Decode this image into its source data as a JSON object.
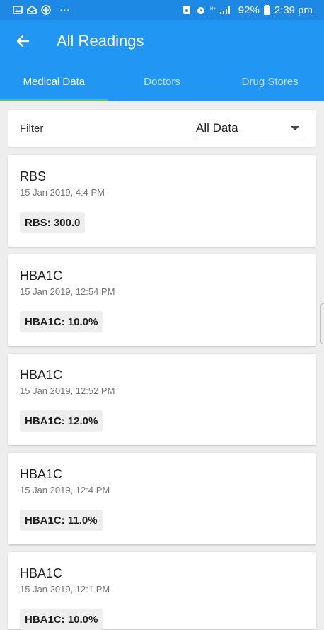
{
  "status_bar": {
    "left_icons": [
      "image-icon",
      "mail-icon",
      "game-icon",
      "more-icon"
    ],
    "battery": "92%",
    "time": "2:39 pm"
  },
  "app_bar": {
    "title": "All Readings"
  },
  "tabs": [
    {
      "label": "Medical Data",
      "active": true
    },
    {
      "label": "Doctors",
      "active": false
    },
    {
      "label": "Drug Stores",
      "active": false
    }
  ],
  "filter": {
    "label": "Filter",
    "value": "All Data"
  },
  "readings": [
    {
      "title": "RBS",
      "date": "15 Jan 2019, 4:4 PM",
      "badge": "RBS: 300.0"
    },
    {
      "title": "HBA1C",
      "date": "15 Jan 2019, 12:54 PM",
      "badge": "HBA1C: 10.0%"
    },
    {
      "title": "HBA1C",
      "date": "15 Jan 2019, 12:52 PM",
      "badge": "HBA1C: 12.0%"
    },
    {
      "title": "HBA1C",
      "date": "15 Jan 2019, 12:4 PM",
      "badge": "HBA1C: 11.0%"
    },
    {
      "title": "HBA1C",
      "date": "15 Jan 2019, 12:1 PM",
      "badge": "HBA1C: 10.0%"
    }
  ],
  "colors": {
    "primary": "#2196f3",
    "status_bar": "#1e88e5",
    "tab_indicator": "#66bb6a"
  }
}
